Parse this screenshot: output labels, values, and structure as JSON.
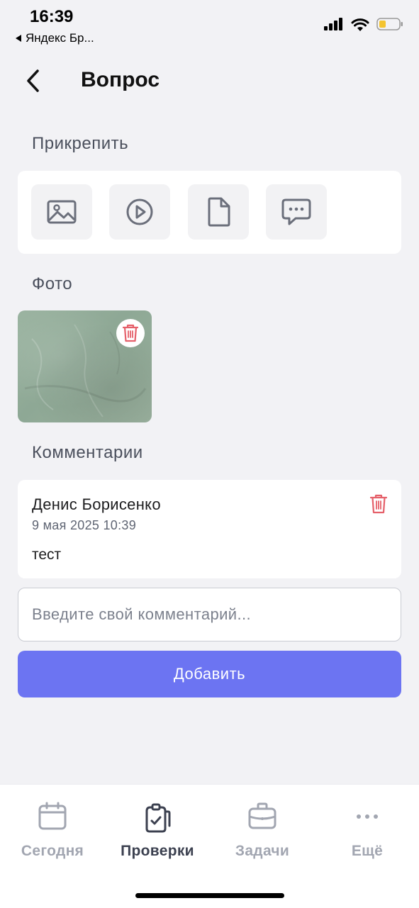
{
  "status": {
    "time": "16:39",
    "back_app": "Яндекс Бр..."
  },
  "header": {
    "title": "Вопрос",
    "back_icon": "chevron-left-icon"
  },
  "attach": {
    "title": "Прикрепить",
    "buttons": [
      {
        "icon": "image-icon"
      },
      {
        "icon": "video-play-icon"
      },
      {
        "icon": "document-icon"
      },
      {
        "icon": "comment-bubble-icon"
      }
    ]
  },
  "photos": {
    "title": "Фото",
    "delete_icon": "trash-icon"
  },
  "comments": {
    "title": "Комментарии",
    "items": [
      {
        "author": "Денис Борисенко",
        "date": "9 мая 2025 10:39",
        "text": "тест"
      }
    ],
    "input_placeholder": "Введите свой комментарий...",
    "add_label": "Добавить"
  },
  "tabbar": {
    "items": [
      {
        "label": "Сегодня",
        "icon": "calendar-icon",
        "active": false
      },
      {
        "label": "Проверки",
        "icon": "clipboard-check-icon",
        "active": true
      },
      {
        "label": "Задачи",
        "icon": "briefcase-icon",
        "active": false
      },
      {
        "label": "Ещё",
        "icon": "more-dots-icon",
        "active": false
      }
    ]
  },
  "colors": {
    "accent": "#6c74f2",
    "danger": "#e5606a",
    "background": "#f2f2f5",
    "tab_active": "#3c4150",
    "tab_inactive": "#a2a6b1"
  }
}
